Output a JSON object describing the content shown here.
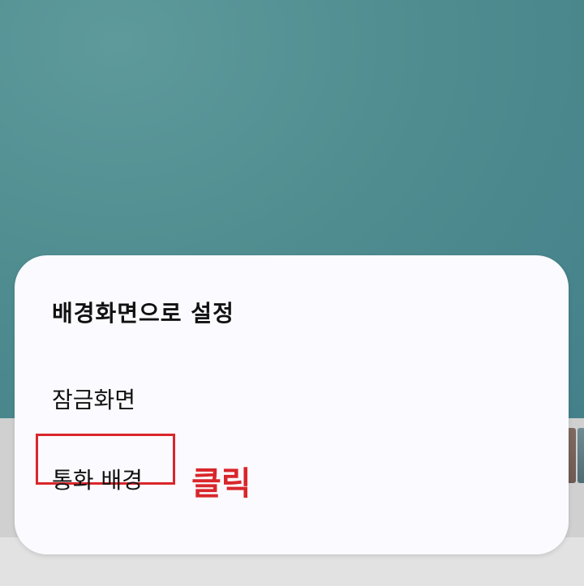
{
  "menu": {
    "title": "배경화면으로 설정",
    "items": [
      {
        "label": "잠금화면"
      },
      {
        "label": "통화 배경"
      }
    ]
  },
  "annotation": {
    "text": "클릭",
    "color": "#d9262b"
  },
  "colors": {
    "wallpaper": "#4f8d90",
    "sheet": "#fbfafe"
  }
}
